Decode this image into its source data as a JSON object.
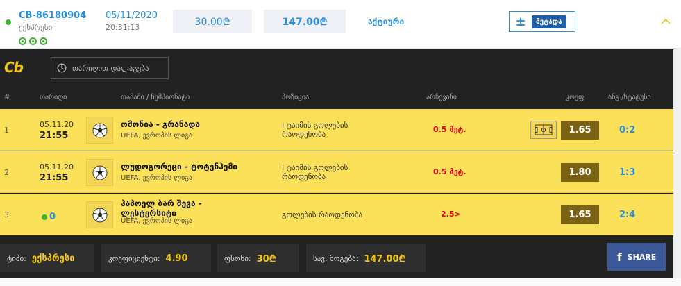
{
  "bet": {
    "id": "CB-86180904",
    "type": "ექსპრესი",
    "date": "05/11/2020",
    "time": "20:31:13",
    "stake": "30.00₾",
    "win": "147.00₾",
    "status": "აქტიური",
    "details_label": "მეტადა",
    "details_symbol": "±",
    "status_color": "#3cb531",
    "accent_color": "#2b90d9"
  },
  "panel": {
    "logo": "Cb",
    "date_filter_label": "თარიღით დალაგება",
    "columns": [
      "#",
      "თარიღი",
      "თამაში / ჩემპიონატი",
      "პოზიცია",
      "არჩევანი",
      "კოეფ",
      "ანგ./სტატუსი"
    ]
  },
  "rows": [
    {
      "num": "1",
      "date": "05.11.20",
      "time": "21:55",
      "teams": "ომონია - გრანადა",
      "league": "UEFA, ევროპის ლიგა",
      "market": "I ტაიმის გოლების რაოდენობა",
      "pick": "0.5 მეტ.",
      "odd": "1.65",
      "score": "0:2",
      "has_field_icon": true
    },
    {
      "num": "2",
      "date": "05.11.20",
      "time": "21:55",
      "teams": "ლუდოგორეცი - ტოტენჰემი",
      "league": "UEFA, ევროპის ლიგა",
      "market": "I ტაიმის გოლების რაოდენობა",
      "pick": "0.5 მეტ.",
      "odd": "1.80",
      "score": "1:3",
      "has_field_icon": false
    },
    {
      "num": "3",
      "live_score": "0",
      "teams_line1": "ჰაპოელ ბარ შევა -",
      "teams_line2": "ლესტერსიტი",
      "league": "UEFA, ევროპის ლიგა",
      "market": "გოლების რაოდენობა",
      "pick": "2.5>",
      "odd": "1.65",
      "score": "2:4",
      "has_field_icon": false
    }
  ],
  "footer": {
    "type_key": "ტიპი:",
    "type_val": "ექსპრესი",
    "coef_key": "კოეფიციენტი:",
    "coef_val": "4.90",
    "stake_key": "ფსონი:",
    "stake_val": "30₾",
    "total_key": "სავ. მოგება:",
    "total_val": "147.00₾",
    "share_f": "f",
    "share_label": "SHARE"
  }
}
